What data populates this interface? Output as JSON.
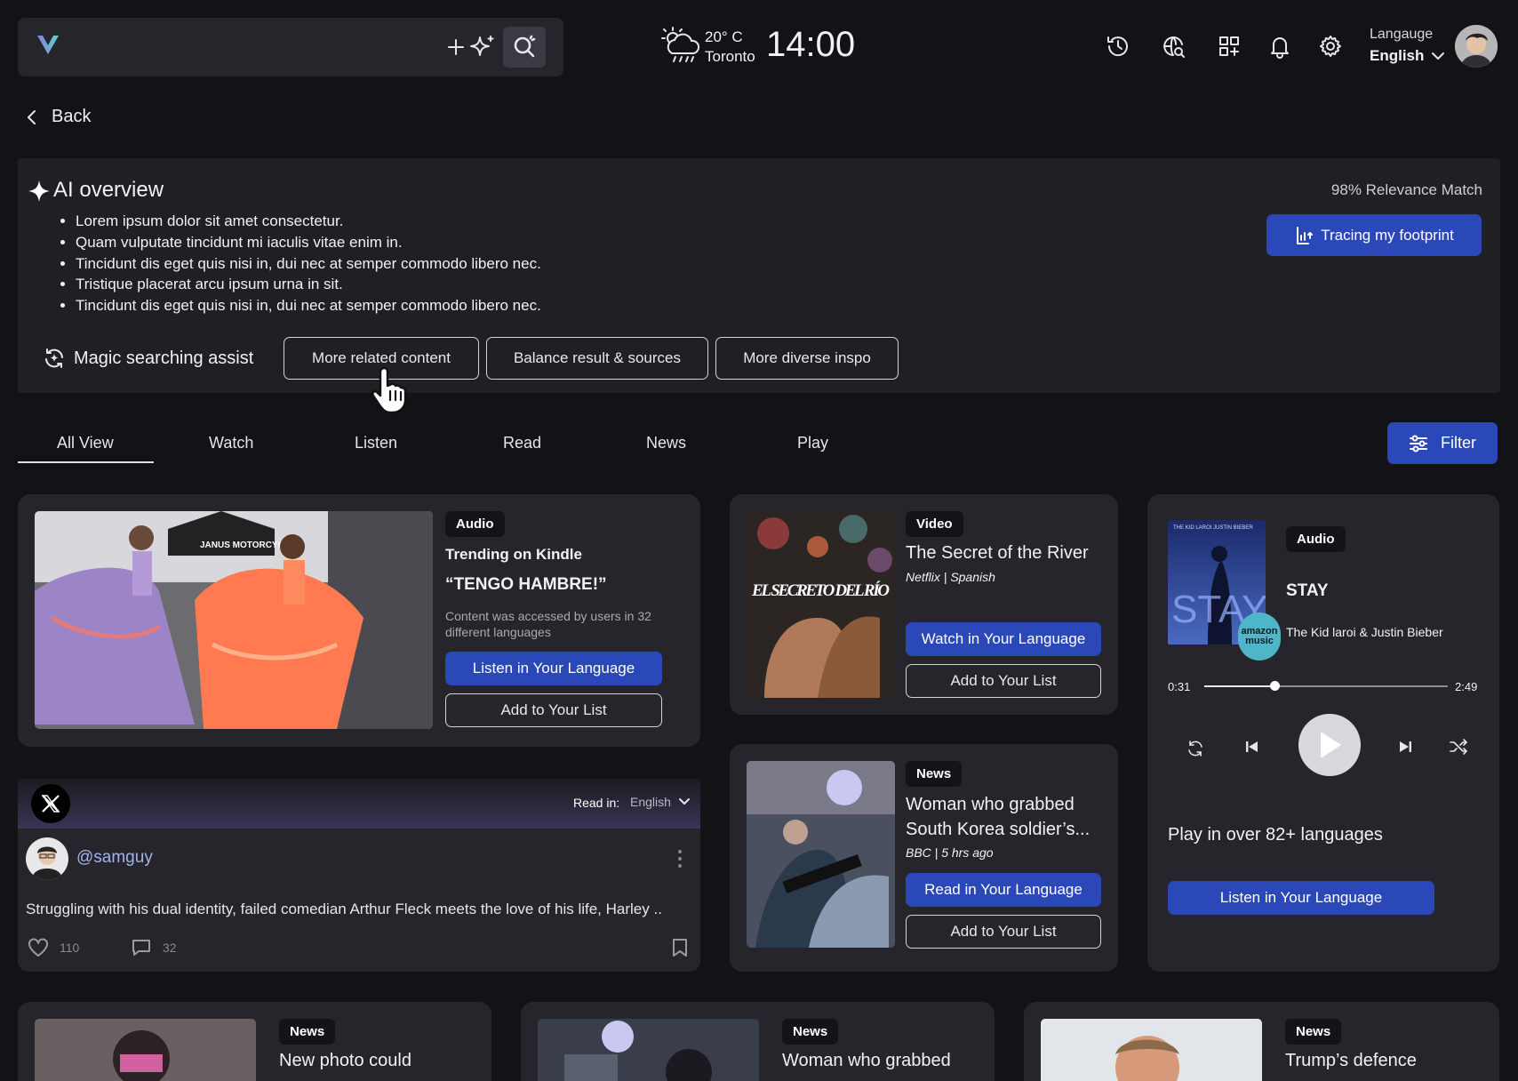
{
  "search": {
    "placeholder": ""
  },
  "weather": {
    "temp": "20° C",
    "city": "Toronto",
    "time": "14:00"
  },
  "language": {
    "label": "Langauge",
    "value": "English"
  },
  "nav": {
    "back": "Back"
  },
  "ai": {
    "title": "AI overview",
    "relevance": "98% Relevance Match",
    "footprint": "Tracing my footprint",
    "bullets": [
      "Lorem ipsum dolor sit amet consectetur.",
      "Quam vulputate tincidunt mi iaculis vitae enim in.",
      "Tincidunt dis eget quis nisi in, dui nec at semper commodo libero nec.",
      "Tristique placerat arcu ipsum urna in sit.",
      "Tincidunt dis eget quis nisi in, dui nec at semper commodo libero nec."
    ],
    "assist": "Magic searching assist",
    "chips": [
      "More related content",
      "Balance result & sources",
      "More diverse inspo"
    ]
  },
  "tabs": [
    "All View",
    "Watch",
    "Listen",
    "Read",
    "News",
    "Play"
  ],
  "filter": "Filter",
  "card1": {
    "tag": "Audio",
    "kicker": "Trending on Kindle",
    "title": "“TENGO HAMBRE!”",
    "desc": "Content was accessed by users in 32 different languages",
    "primary": "Listen in Your Language",
    "secondary": "Add to Your List",
    "image_text": "JANUS MOTORCYC"
  },
  "card2": {
    "tag": "Video",
    "title": "The Secret of the River",
    "meta": "Netflix | Spanish",
    "primary": "Watch in Your Language",
    "secondary": "Add to Your List",
    "poster_text": "EL SECRETO DEL RÍO"
  },
  "card3": {
    "tag": "News",
    "title": "Woman who grabbed South Korea soldier’s...",
    "meta": "BBC | 5 hrs ago",
    "primary": "Read in Your Language",
    "secondary": "Add to Your List"
  },
  "post": {
    "read_in": "Read in:",
    "lang": "English",
    "user": "@samguy",
    "text": "Struggling with his dual identity, failed comedian Arthur Fleck meets the love of his life, Harley ..",
    "likes": "110",
    "comments": "32"
  },
  "player": {
    "tag": "Audio",
    "title": "STAY",
    "artist": "The Kid laroi & Justin Bieber",
    "current": "0:31",
    "total": "2:49",
    "progress": 0.29,
    "badge": "amazon music",
    "cover_text": "STAY",
    "cover_top": "THE KID LAROI   JUSTIN BIEBER",
    "promo": "Play in over 82+ languages",
    "cta": "Listen in Your Language"
  },
  "bottom": [
    {
      "tag": "News",
      "title": "New photo could"
    },
    {
      "tag": "News",
      "title": "Woman who grabbed"
    },
    {
      "tag": "News",
      "title": "Trump’s defence"
    }
  ],
  "colors": {
    "accent": "#2b48b8",
    "bg": "#131317",
    "card": "#25252b"
  }
}
